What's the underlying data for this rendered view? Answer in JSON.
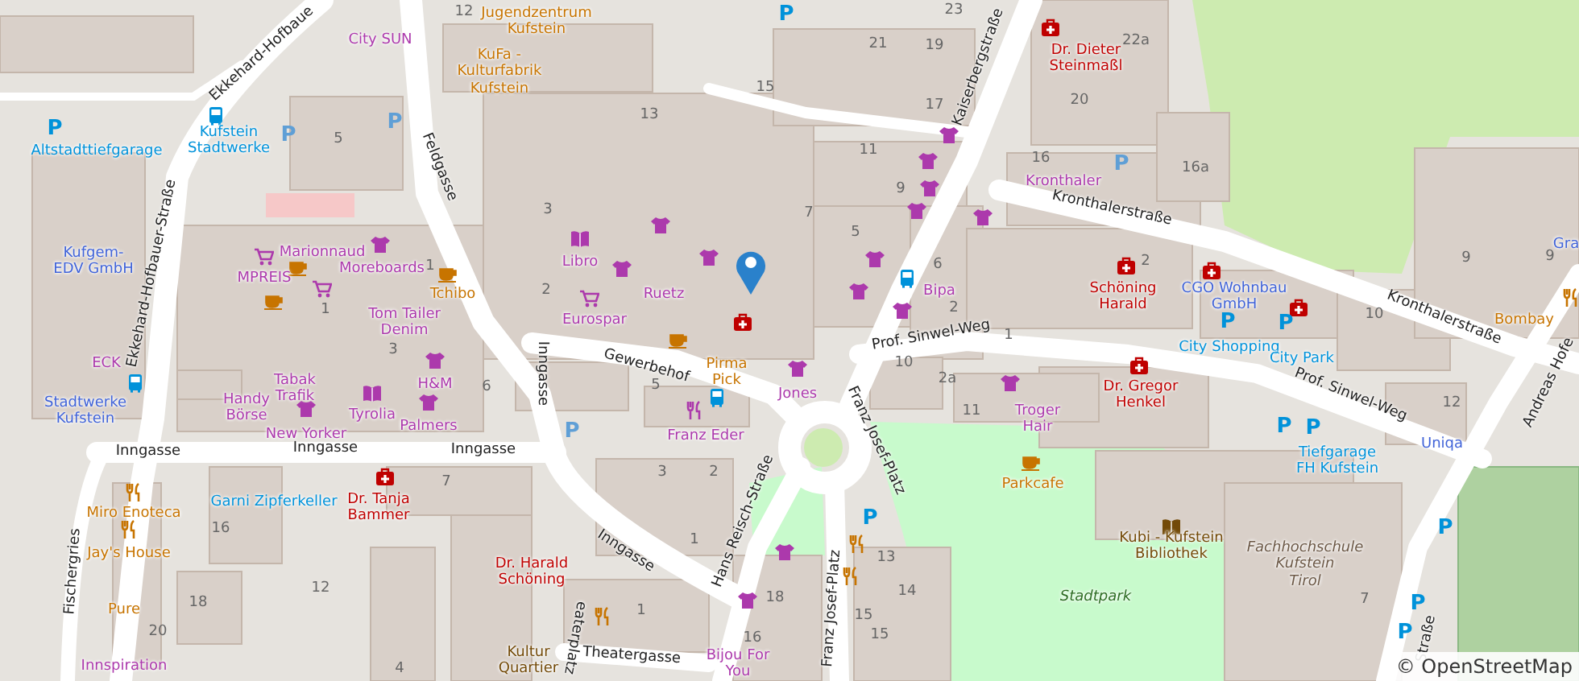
{
  "map": {
    "streets": [
      {
        "name": "Ekkehard-Hofbaue"
      },
      {
        "name": "Ekkehard-Hofbauer-Straße"
      },
      {
        "name": "Feldgasse"
      },
      {
        "name": "Kaiserbergstraße"
      },
      {
        "name": "Kronthalerstraße"
      },
      {
        "name": "Kronthalerstraße"
      },
      {
        "name": "Andreas Hofe"
      },
      {
        "name": "Prof. Sinwel-Weg"
      },
      {
        "name": "Prof. Sinwel-Weg"
      },
      {
        "name": "Gewerbehof"
      },
      {
        "name": "Inngasse"
      },
      {
        "name": "Inngasse"
      },
      {
        "name": "Inngasse"
      },
      {
        "name": "Inngasse"
      },
      {
        "name": "Inngasse"
      },
      {
        "name": "Hans Reisch-Straße"
      },
      {
        "name": "Franz Josef-Platz"
      },
      {
        "name": "Franz Josef-Platz"
      },
      {
        "name": "Theatergasse"
      },
      {
        "name": "Fischergries"
      },
      {
        "name": "Straße"
      },
      {
        "name": "eaterplatz"
      }
    ],
    "places": [
      {
        "name": "City SUN",
        "kind": "shop"
      },
      {
        "name": "Jugendzentrum\nKufstein",
        "kind": "food"
      },
      {
        "name": "KuFa -\nKulturfabrik\nKufstein",
        "kind": "food"
      },
      {
        "name": "Altstadttiefgarage",
        "kind": "transport"
      },
      {
        "name": "Kufstein\nStadtwerke",
        "kind": "transport"
      },
      {
        "name": "Kufgem-\nEDV GmbH",
        "kind": "office"
      },
      {
        "name": "Marionnaud",
        "kind": "shop"
      },
      {
        "name": "Moreboards",
        "kind": "shop"
      },
      {
        "name": "MPREIS",
        "kind": "shop"
      },
      {
        "name": "Tchibo",
        "kind": "food"
      },
      {
        "name": "Tom Tailer\nDenim",
        "kind": "shop"
      },
      {
        "name": "Libro",
        "kind": "shop"
      },
      {
        "name": "Ruetz",
        "kind": "shop"
      },
      {
        "name": "Eurospar",
        "kind": "shop"
      },
      {
        "name": "Dr. Dieter\nSteinmaßl",
        "kind": "health"
      },
      {
        "name": "Kronthaler",
        "kind": "shop"
      },
      {
        "name": "Bipa",
        "kind": "shop"
      },
      {
        "name": "Schöning\nHarald",
        "kind": "health"
      },
      {
        "name": "CGO Wohnbau\nGmbH",
        "kind": "office"
      },
      {
        "name": "City Shopping",
        "kind": "transport"
      },
      {
        "name": "City Park",
        "kind": "transport"
      },
      {
        "name": "Gra",
        "kind": "office"
      },
      {
        "name": "Bombay",
        "kind": "food"
      },
      {
        "name": "Dr. Gregor\nHenkel",
        "kind": "health"
      },
      {
        "name": "Pirma\nPick",
        "kind": "food"
      },
      {
        "name": "Jones",
        "kind": "shop"
      },
      {
        "name": "ECK",
        "kind": "shop"
      },
      {
        "name": "Stadtwerke\nKufstein",
        "kind": "office"
      },
      {
        "name": "Handy\nBörse",
        "kind": "shop"
      },
      {
        "name": "Tabak\nTrafik",
        "kind": "shop"
      },
      {
        "name": "H&M",
        "kind": "shop"
      },
      {
        "name": "Tyrolia",
        "kind": "shop"
      },
      {
        "name": "Palmers",
        "kind": "shop"
      },
      {
        "name": "New Yorker",
        "kind": "shop"
      },
      {
        "name": "Franz Eder",
        "kind": "shop"
      },
      {
        "name": "Troger\nHair",
        "kind": "shop"
      },
      {
        "name": "Parkcafe",
        "kind": "food"
      },
      {
        "name": "Uniqa",
        "kind": "office"
      },
      {
        "name": "Tiefgarage\nFH Kufstein",
        "kind": "transport"
      },
      {
        "name": "Miro Enoteca",
        "kind": "food"
      },
      {
        "name": "Garni Zipferkeller",
        "kind": "transport"
      },
      {
        "name": "Dr. Tanja\nBammer",
        "kind": "health"
      },
      {
        "name": "Jay's House",
        "kind": "food"
      },
      {
        "name": "Pure",
        "kind": "food"
      },
      {
        "name": "Innspiration",
        "kind": "shop"
      },
      {
        "name": "Dr. Harald\nSchöning",
        "kind": "health"
      },
      {
        "name": "Kultur\nQuartier",
        "kind": "culture"
      },
      {
        "name": "Kubi - Kufstein\nBibliothek",
        "kind": "culture"
      },
      {
        "name": "Fachhochschule\nKufstein\nTirol",
        "kind": "education"
      },
      {
        "name": "Stadtpark",
        "kind": "park"
      },
      {
        "name": "Bijou For\nYou",
        "kind": "shop"
      }
    ],
    "house_numbers": [
      "12",
      "5",
      "13",
      "15",
      "23",
      "21",
      "19",
      "17",
      "22a",
      "20",
      "16",
      "16a",
      "11",
      "9",
      "7",
      "5",
      "6",
      "2",
      "1",
      "3",
      "2",
      "1",
      "1",
      "2",
      "10",
      "9",
      "9",
      "12",
      "10",
      "2a",
      "11",
      "6",
      "3",
      "5",
      "3",
      "2",
      "1",
      "7",
      "16",
      "18",
      "20",
      "12",
      "4",
      "1",
      "18",
      "16",
      "13",
      "14",
      "15",
      "15",
      "7"
    ],
    "parking_signs": [
      {
        "label": "P",
        "kind": "public"
      },
      {
        "label": "P",
        "kind": "private"
      },
      {
        "label": "P",
        "kind": "private"
      },
      {
        "label": "P",
        "kind": "private"
      },
      {
        "label": "P",
        "kind": "private"
      },
      {
        "label": "P",
        "kind": "public"
      },
      {
        "label": "P",
        "kind": "public"
      },
      {
        "label": "P",
        "kind": "public"
      },
      {
        "label": "P",
        "kind": "public"
      },
      {
        "label": "P",
        "kind": "public"
      },
      {
        "label": "P",
        "kind": "public"
      },
      {
        "label": "P",
        "kind": "public"
      },
      {
        "label": "P",
        "kind": "public"
      },
      {
        "label": "P",
        "kind": "public"
      }
    ],
    "attribution": "© OpenStreetMap"
  }
}
